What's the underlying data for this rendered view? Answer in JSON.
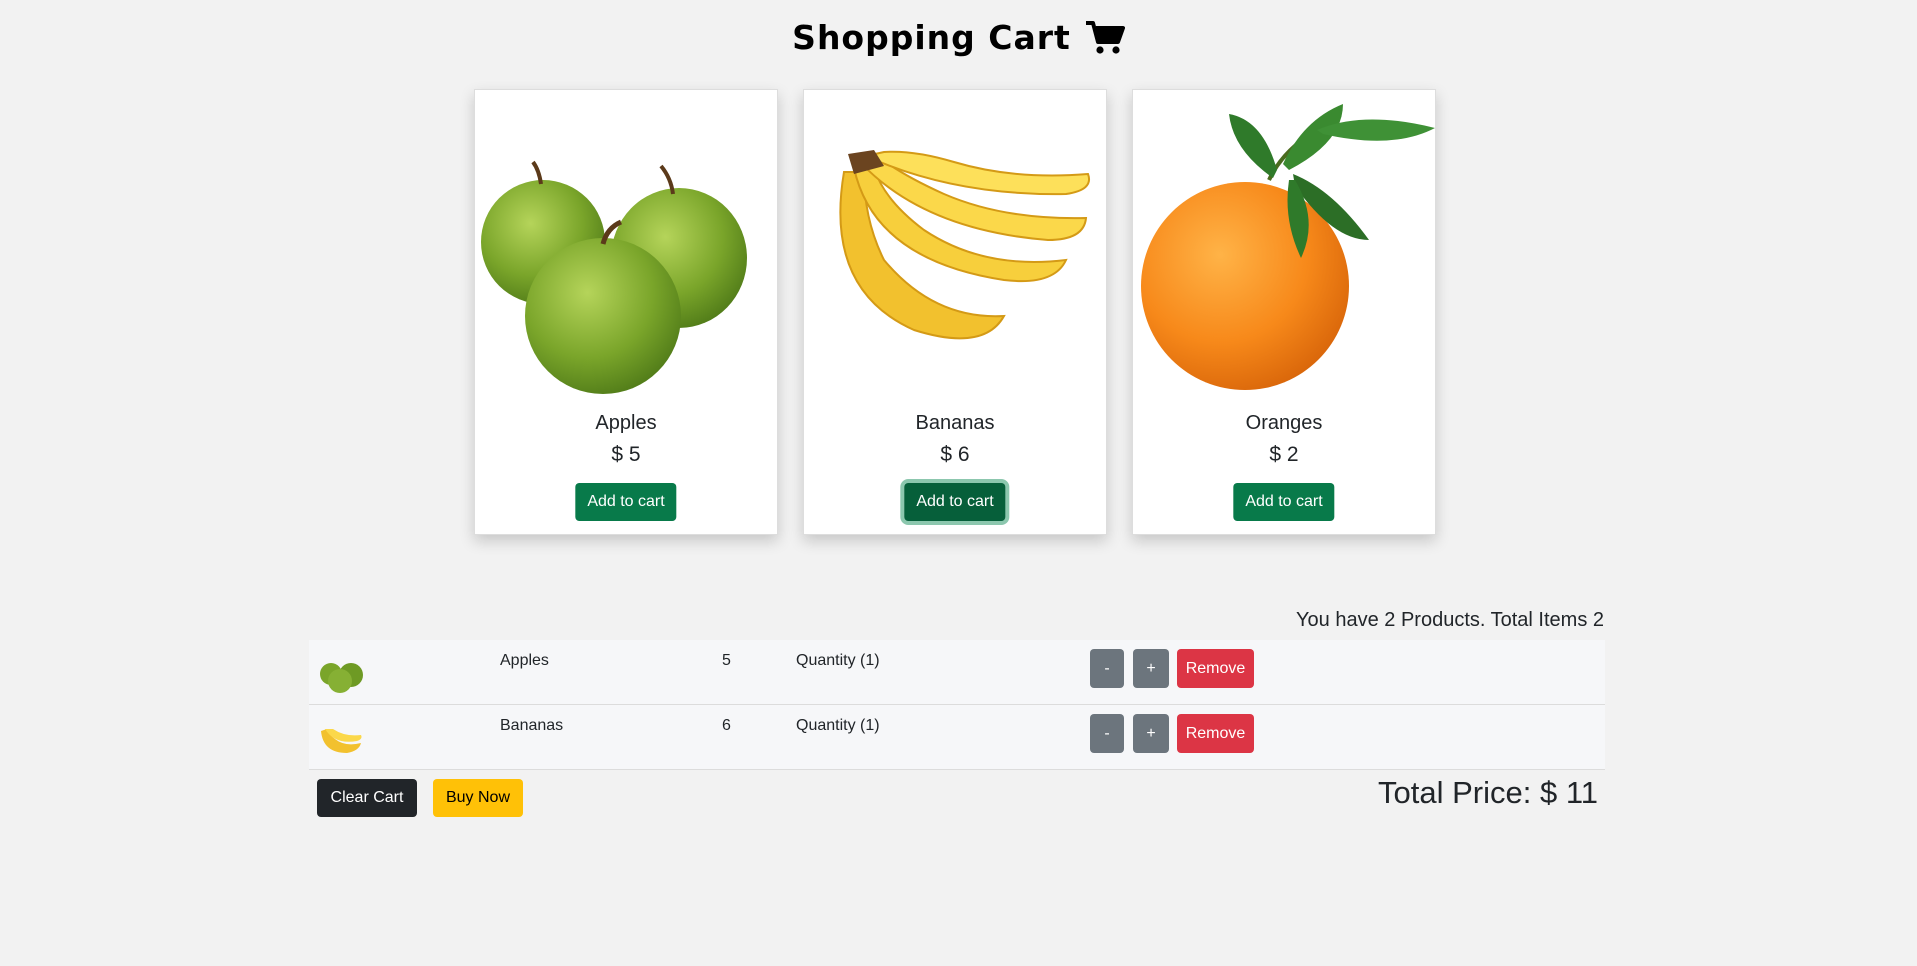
{
  "header": {
    "title": "Shopping Cart",
    "icon": "cart-icon"
  },
  "products": [
    {
      "name": "Apples",
      "price": "$ 5",
      "button": "Add to cart",
      "icon": "apples-image"
    },
    {
      "name": "Bananas",
      "price": "$ 6",
      "button": "Add to cart",
      "icon": "bananas-image"
    },
    {
      "name": "Oranges",
      "price": "$ 2",
      "button": "Add to cart",
      "icon": "orange-image"
    }
  ],
  "cart": {
    "summary": "You have 2 Products. Total Items 2",
    "items": [
      {
        "name": "Apples",
        "price": "5",
        "quantity": "Quantity (1)",
        "minus": "-",
        "plus": "+",
        "remove": "Remove",
        "icon": "apples-thumbnail"
      },
      {
        "name": "Bananas",
        "price": "6",
        "quantity": "Quantity (1)",
        "minus": "-",
        "plus": "+",
        "remove": "Remove",
        "icon": "bananas-thumbnail"
      }
    ],
    "clear_label": "Clear Cart",
    "buy_label": "Buy Now",
    "total": "Total Price: $ 11"
  },
  "colors": {
    "add_button": "#087a4a",
    "remove_button": "#dc3545",
    "qty_button": "#6c757d",
    "clear_button": "#212529",
    "buy_button": "#ffc107"
  }
}
